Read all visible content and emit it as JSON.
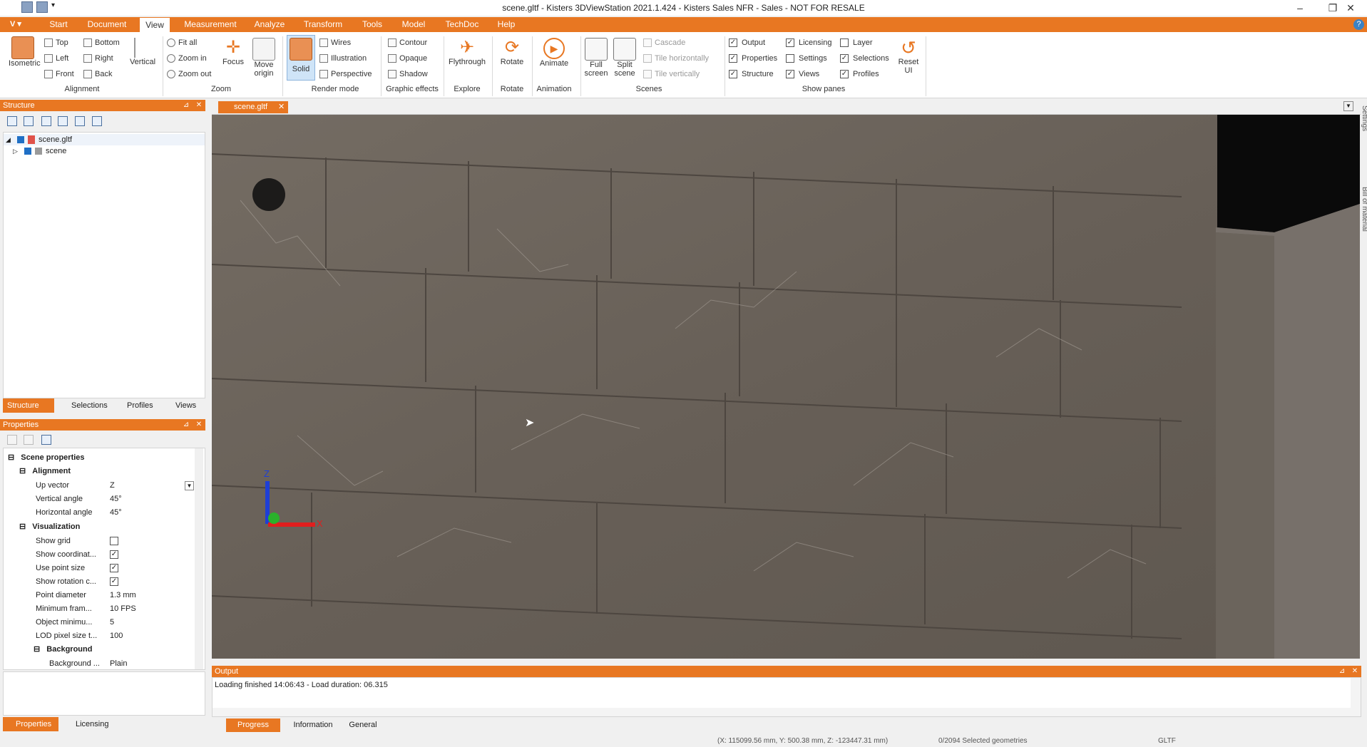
{
  "window": {
    "title": "scene.gltf - Kisters 3DViewStation 2021.1.424 - Kisters Sales NFR - Sales - NOT FOR RESALE",
    "minimize": "–",
    "restore": "❐",
    "close": "✕"
  },
  "app_button": "V",
  "tabs": [
    "Start",
    "Document",
    "View",
    "Measurement",
    "Analyze",
    "Transform",
    "Tools",
    "Model",
    "TechDoc",
    "Help"
  ],
  "active_tab": "View",
  "ribbon": {
    "alignment": {
      "isometric": "Isometric",
      "top": "Top",
      "left": "Left",
      "front": "Front",
      "bottom": "Bottom",
      "right": "Right",
      "back": "Back",
      "vertical": "Vertical",
      "group": "Alignment"
    },
    "zoom": {
      "fit_all": "Fit all",
      "zoom_in": "Zoom in",
      "zoom_out": "Zoom out",
      "focus": "Focus",
      "move_origin": "Move origin",
      "group": "Zoom"
    },
    "render_mode": {
      "solid": "Solid",
      "wires": "Wires",
      "illustration": "Illustration",
      "perspective": "Perspective",
      "group": "Render mode"
    },
    "graphic_effects": {
      "contour": "Contour",
      "opaque": "Opaque",
      "shadow": "Shadow",
      "group": "Graphic effects"
    },
    "explore": {
      "flythrough": "Flythrough",
      "group": "Explore"
    },
    "rotate": {
      "rotate": "Rotate",
      "group": "Rotate"
    },
    "animation": {
      "animate": "Animate",
      "group": "Animation"
    },
    "scenes": {
      "full_screen": "Full screen",
      "split_scene": "Split scene",
      "cascade": "Cascade",
      "tile_h": "Tile horizontally",
      "tile_v": "Tile vertically",
      "group": "Scenes"
    },
    "show_panes": {
      "group": "Show panes",
      "items": [
        {
          "label": "Output",
          "checked": true
        },
        {
          "label": "Properties",
          "checked": true
        },
        {
          "label": "Structure",
          "checked": true
        },
        {
          "label": "Licensing",
          "checked": true
        },
        {
          "label": "Settings",
          "checked": false
        },
        {
          "label": "Views",
          "checked": true
        },
        {
          "label": "Layer",
          "checked": false
        },
        {
          "label": "Selections",
          "checked": true
        },
        {
          "label": "Profiles",
          "checked": true
        }
      ]
    },
    "reset": {
      "label": "Reset UI"
    }
  },
  "structure_panel": {
    "title": "Structure",
    "tree": [
      {
        "label": "scene.gltf"
      },
      {
        "label": "scene"
      }
    ],
    "tabs": [
      "Structure",
      "Selections",
      "Profiles",
      "Views"
    ]
  },
  "properties_panel": {
    "title": "Properties",
    "section": "Scene properties",
    "alignment": "Alignment",
    "visualization": "Visualization",
    "background": "Background",
    "rows": [
      {
        "key": "Up vector",
        "value": "Z"
      },
      {
        "key": "Vertical angle",
        "value": "45°"
      },
      {
        "key": "Horizontal angle",
        "value": "45°"
      },
      {
        "key": "Show grid",
        "value": ""
      },
      {
        "key": "Show coordinat...",
        "value": "✓"
      },
      {
        "key": "Use point size",
        "value": "✓"
      },
      {
        "key": "Show rotation c...",
        "value": "✓"
      },
      {
        "key": "Point diameter",
        "value": "1.3 mm"
      },
      {
        "key": "Minimum fram...",
        "value": "10 FPS"
      },
      {
        "key": "Object minimu...",
        "value": "5"
      },
      {
        "key": "LOD pixel size t...",
        "value": "100"
      },
      {
        "key": "Background ...",
        "value": "Plain"
      }
    ],
    "bottom_tabs": [
      "Properties",
      "Licensing"
    ]
  },
  "document_tab": "scene.gltf",
  "side_tabs": [
    "Settings",
    "Bill of material"
  ],
  "axis_labels": {
    "z": "Z",
    "x": "X"
  },
  "output_panel": {
    "title": "Output",
    "message": "Loading finished 14:06:43 - Load duration: 06.315",
    "tabs": [
      "Progress",
      "Information",
      "General"
    ]
  },
  "status": {
    "coords": "(X: 115099.56 mm, Y: 500.38 mm, Z: -123447.31 mm)",
    "selection": "0/2094 Selected geometries",
    "format": "GLTF"
  },
  "colors": {
    "accent": "#e87722",
    "marble": "#6a625a"
  }
}
